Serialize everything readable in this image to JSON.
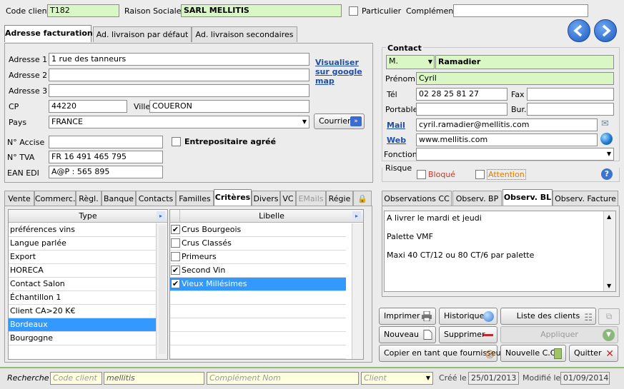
{
  "header": {
    "code_client_label": "Code client",
    "code_client_value": "T182",
    "raison_sociale_label": "Raison Sociale",
    "raison_sociale_value": "SARL MELLITIS",
    "particulier_label": "Particulier",
    "complement_label": "Complément",
    "complement_value": ""
  },
  "address_tabs": [
    "Adresse facturation",
    "Ad. livraison par défaut",
    "Ad. livraison secondaires"
  ],
  "address": {
    "adresse1_label": "Adresse 1",
    "adresse1_value": "1 rue des tanneurs",
    "adresse2_label": "Adresse 2",
    "adresse2_value": "",
    "adresse3_label": "Adresse 3",
    "adresse3_value": "",
    "cp_label": "CP",
    "cp_value": "44220",
    "ville_label": "Ville",
    "ville_value": "COUERON",
    "pays_label": "Pays",
    "pays_value": "FRANCE",
    "map_link": "Visualiser sur google map",
    "courrier_label": "Courrier",
    "accise_label": "N° Accise",
    "accise_value": "",
    "entrepositaire_label": "Entrepositaire agréé",
    "tva_label": "N° TVA",
    "tva_value": "FR 16 491 465 795",
    "ean_label": "EAN EDI",
    "ean_value": "A@P : 565 895"
  },
  "contact": {
    "title": "Contact",
    "civilite": "M.",
    "nom": "Ramadier",
    "prenom_label": "Prénom",
    "prenom_value": "Cyril",
    "tel_label": "Tél",
    "tel_value": "02 28 25 81 27",
    "fax_label": "Fax",
    "fax_value": "",
    "portable_label": "Portable",
    "portable_value": "",
    "bur_label": "Bur.",
    "bur_value": "",
    "mail_label": "Mail",
    "mail_value": "cyril.ramadier@mellitis.com",
    "web_label": "Web",
    "web_value": "www.mellitis.com",
    "fonction_label": "Fonction",
    "fonction_value": ""
  },
  "risque": {
    "title": "Risque",
    "bloque_label": "Bloqué",
    "attention_label": "Attention"
  },
  "lower_tabs": [
    "Vente",
    "Commerc.",
    "Règl.",
    "Banque",
    "Contacts",
    "Familles",
    "Critères",
    "Divers",
    "VC",
    "EMails",
    "Régie"
  ],
  "type_list": {
    "header": "Type",
    "items": [
      "préférences vins",
      "Langue parlée",
      "Export",
      "HORECA",
      "Contact Salon",
      "Échantillon 1",
      "Client CA>20 K€",
      "Bordeaux",
      "Bourgogne"
    ],
    "selected_index": 7
  },
  "libelle_list": {
    "header": "Libelle",
    "items": [
      {
        "label": "Crus Bourgeois",
        "checked": true
      },
      {
        "label": "Crus Classés",
        "checked": false
      },
      {
        "label": "Primeurs",
        "checked": false
      },
      {
        "label": "Second Vin",
        "checked": true
      },
      {
        "label": "Vieux Millésimes",
        "checked": true
      }
    ],
    "selected_index": 4
  },
  "obs_tabs": [
    "Observations CC",
    "Observ. BP",
    "Observ. BL",
    "Observ. Facture"
  ],
  "observations": {
    "lines": [
      "A livrer le mardi et jeudi",
      "Palette VMF",
      "Maxi 40 CT/12 ou 80 CT/6 par palette"
    ]
  },
  "buttons": {
    "imprimer": "Imprimer",
    "historique": "Historique",
    "liste_clients": "Liste des clients",
    "nouveau": "Nouveau",
    "supprimer": "Supprimer",
    "appliquer": "Appliquer",
    "copier": "Copier en tant que fournisseur",
    "nouvelle_cc": "Nouvelle C.C.",
    "quitter": "Quitter"
  },
  "search": {
    "label": "Recherche",
    "code_placeholder": "Code client",
    "nom_value": "mellitis",
    "complement_placeholder": "Complément Nom",
    "client_placeholder": "Client",
    "cree_label": "Créé le",
    "cree_value": "25/01/2013",
    "modifie_label": "Modifié le",
    "modifie_value": "01/09/2014"
  },
  "colors": {
    "green_field": "#d9f7c4",
    "selection": "#3399ff",
    "link": "#1e4ea8",
    "nav_blue": "#2a6fd6"
  }
}
